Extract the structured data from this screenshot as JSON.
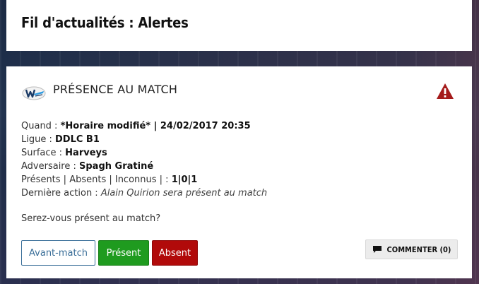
{
  "header": {
    "title": "Fil d'actualités : Alertes"
  },
  "card": {
    "title": "PRÉSENCE AU MATCH",
    "logo_icon": "team-logo-w-icon",
    "alert_icon": "warning-triangle-icon",
    "details": {
      "when_label": "Quand : ",
      "when_value": "*Horaire modifié* | 24/02/2017 20:35",
      "league_label": "Ligue : ",
      "league_value": "DDLC B1",
      "surface_label": "Surface : ",
      "surface_value": "Harveys",
      "opponent_label": "Adversaire : ",
      "opponent_value": "Spagh Gratiné",
      "counts_label": "Présents | Absents | Inconnus | : ",
      "counts_value": "1|0|1",
      "last_action_label": "Dernière action : ",
      "last_action_value": "Alain Quirion sera présent au match"
    },
    "question": "Serez-vous présent au match?",
    "buttons": {
      "avant_match": "Avant-match",
      "present": "Présent",
      "absent": "Absent",
      "comment": "COMMENTER (0)"
    }
  },
  "colors": {
    "present": "#1f9b1f",
    "absent": "#b10a0a",
    "avant_match_border": "#3b6f99",
    "alert": "#a51b1b"
  }
}
